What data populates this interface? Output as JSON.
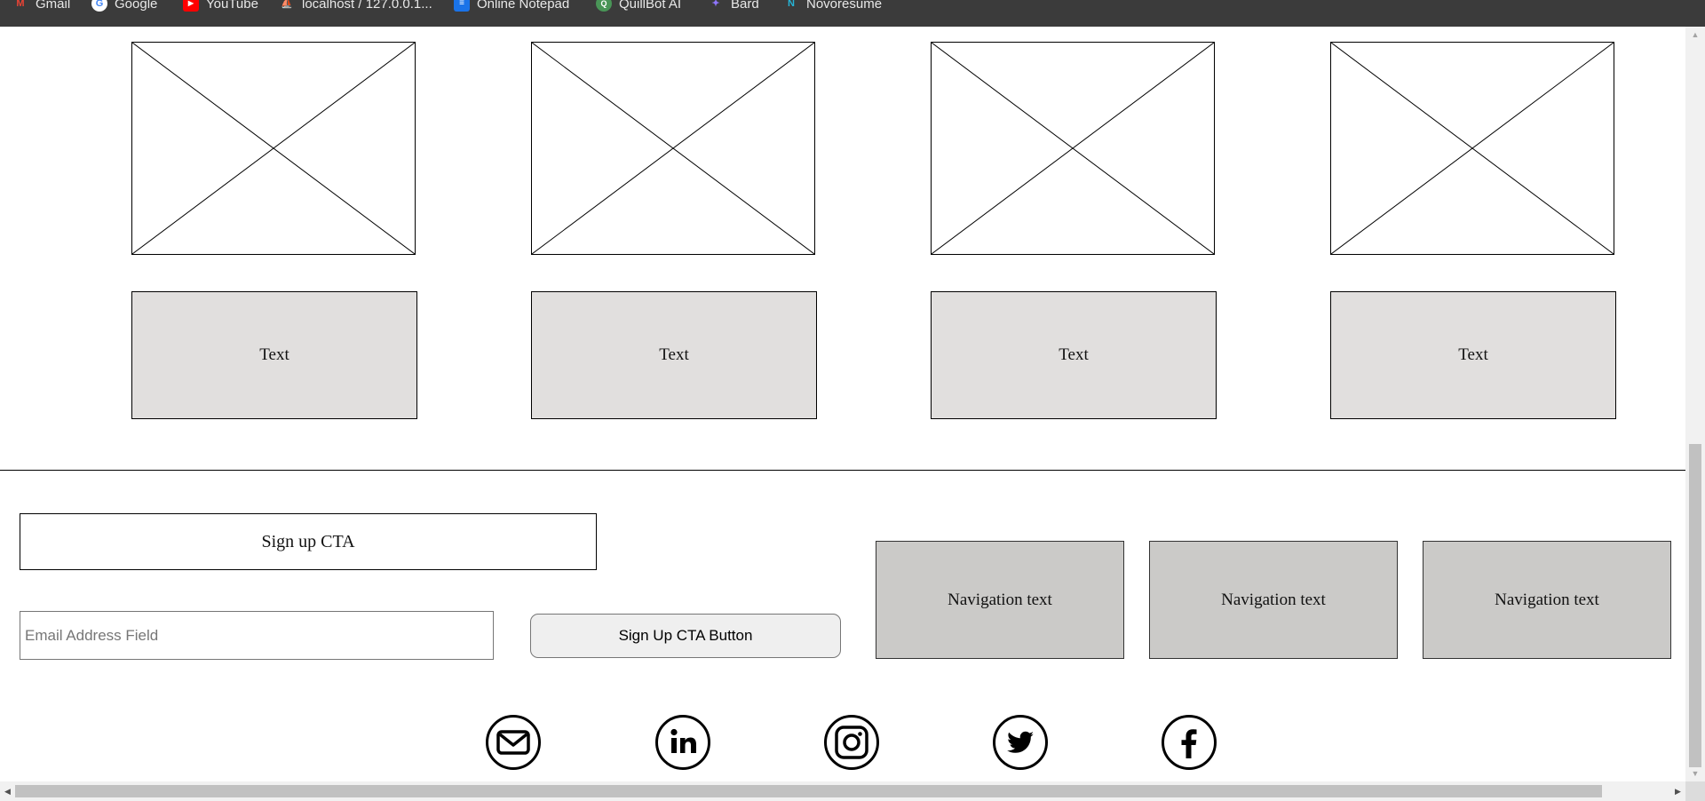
{
  "bookmarks": [
    {
      "label": "Gmail",
      "icon": "gmail-icon",
      "color": "#ea4335"
    },
    {
      "label": "Google",
      "icon": "google-icon",
      "color": "#4285f4"
    },
    {
      "label": "YouTube",
      "icon": "youtube-icon",
      "color": "#ff0000"
    },
    {
      "label": "localhost / 127.0.0.1...",
      "icon": "phpmyadmin-icon",
      "color": "#f89c0e"
    },
    {
      "label": "Online Notepad",
      "icon": "notepad-icon",
      "color": "#1a73e8"
    },
    {
      "label": "QuillBot AI",
      "icon": "quillbot-icon",
      "color": "#499557"
    },
    {
      "label": "Bard",
      "icon": "bard-icon",
      "color": "#8e75ff"
    },
    {
      "label": "Novorésumé",
      "icon": "novoresume-icon",
      "color": "#25b4d6"
    }
  ],
  "products": [
    {
      "image": "placeholder-image",
      "text": "Text"
    },
    {
      "image": "placeholder-image",
      "text": "Text"
    },
    {
      "image": "placeholder-image",
      "text": "Text"
    },
    {
      "image": "placeholder-image",
      "text": "Text"
    }
  ],
  "footer": {
    "cta_heading": "Sign up CTA",
    "email_placeholder": "Email Address Field",
    "cta_button": "Sign Up CTA Button",
    "nav": [
      "Navigation text",
      "Navigation text",
      "Navigation text"
    ],
    "social": [
      "mail-icon",
      "linkedin-icon",
      "instagram-icon",
      "twitter-icon",
      "facebook-icon"
    ]
  },
  "colors": {
    "bookmarks_bg": "#3b3b3b",
    "text_box_bg": "#e1dfde",
    "nav_box_bg": "#cbcac8",
    "button_bg": "#efefef"
  }
}
